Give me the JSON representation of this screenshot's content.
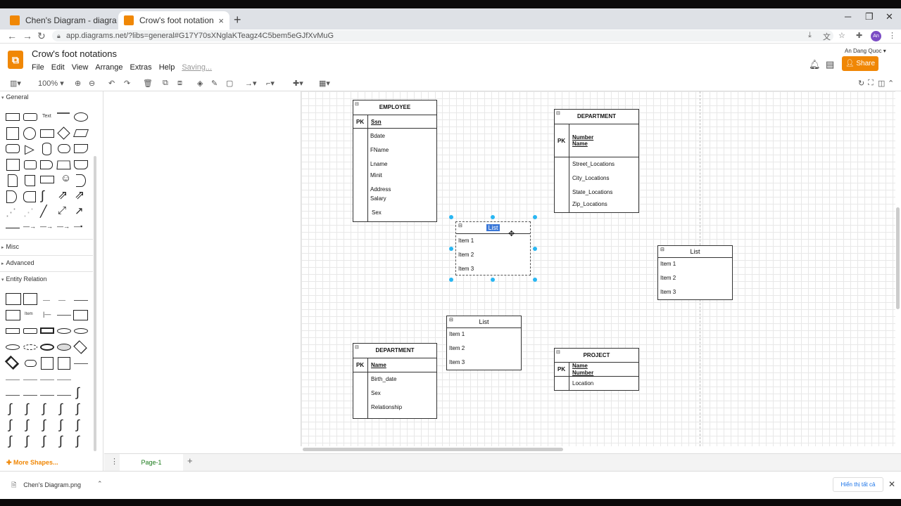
{
  "browser": {
    "tabs": [
      {
        "label": "Chen's Diagram - diagrams.net"
      },
      {
        "label": "Crow's foot notations - diagrams.net"
      }
    ],
    "url": "app.diagrams.net/?libs=general#G17Y70sXNglaKTeagz4C5bem5eGJfXvMuG",
    "avatar_initials": "An"
  },
  "app": {
    "doc_title": "Crow's foot notations",
    "menu": [
      "File",
      "Edit",
      "View",
      "Arrange",
      "Extras",
      "Help"
    ],
    "saving": "Saving...",
    "user_name": "An Dang Quoc",
    "share_label": "Share",
    "zoom": "100%",
    "brand_color": "#f08705"
  },
  "sidebar": {
    "sections": [
      "General",
      "Misc",
      "Advanced",
      "Entity Relation"
    ],
    "text_shape": "Text",
    "item_shape": "Item",
    "more_shapes": "More Shapes..."
  },
  "diagram": {
    "employee": {
      "title": "EMPLOYEE",
      "pk": "PK",
      "key": "Ssn",
      "attrs": [
        "Bdate",
        "FName",
        "Lname",
        "Minit",
        "Address",
        "Salary",
        "Sex"
      ]
    },
    "department_top": {
      "title": "DEPARTMENT",
      "pk": "PK",
      "key1": "Number",
      "key2": "Name",
      "attrs": [
        "Street_Locations",
        "City_Locations",
        "State_Locations",
        "Zip_Locations"
      ]
    },
    "department_bottom": {
      "title": "DEPARTMENT",
      "pk": "PK",
      "key": "Name",
      "attrs": [
        "Birth_date",
        "Sex",
        "Relationship"
      ]
    },
    "project": {
      "title": "PROJECT",
      "pk": "PK",
      "key1": "Name",
      "key2": "Number",
      "attrs": [
        "Location"
      ]
    },
    "list_selected": {
      "title": "List",
      "items": [
        "Item 1",
        "Item 2",
        "Item 3"
      ]
    },
    "list_right": {
      "title": "List",
      "items": [
        "Item 1",
        "Item 2",
        "Item 3"
      ]
    },
    "list_bottom": {
      "title": "List",
      "items": [
        "Item 1",
        "Item 2",
        "Item 3"
      ]
    }
  },
  "pages": {
    "current": "Page-1"
  },
  "downloads": {
    "file": "Chen's Diagram.png",
    "show_all": "Hiển thị tất cả"
  }
}
